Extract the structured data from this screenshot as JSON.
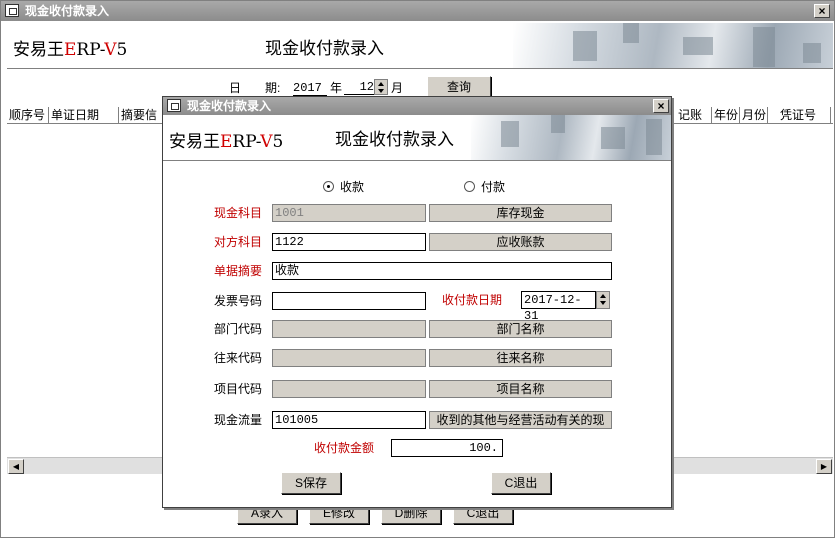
{
  "window": {
    "title": "现金收付款录入",
    "close_label": "×"
  },
  "main_banner": {
    "logo_prefix": "安易王",
    "logo_e": "E",
    "logo_mid": "RP-",
    "logo_v": "V",
    "logo_suffix": "5",
    "title": "现金收付款录入"
  },
  "filter": {
    "date_label": "日　　期:",
    "year": "2017",
    "year_unit": "年",
    "month": "12",
    "month_unit": "月",
    "query_button": "查询"
  },
  "columns": [
    "顺序号",
    "单证日期",
    "摘要信",
    "记账",
    "年份",
    "月份",
    "凭证号"
  ],
  "bottom_buttons": {
    "add": "A录入",
    "modify": "E修改",
    "delete": "D删除",
    "exit": "C退出"
  },
  "dialog": {
    "title": "现金收付款录入",
    "banner": {
      "logo_prefix": "安易王",
      "logo_e": "E",
      "logo_mid": "RP-",
      "logo_v": "V",
      "logo_suffix": "5",
      "title": "现金收付款录入"
    },
    "radio_receive": "收款",
    "radio_pay": "付款",
    "cash_account_label": "现金科目",
    "cash_account_value": "1001",
    "cash_account_name": "库存现金",
    "counter_account_label": "对方科目",
    "counter_account_value": "1122",
    "counter_account_name": "应收账款",
    "summary_label": "单据摘要",
    "summary_value": "收款",
    "invoice_label": "发票号码",
    "invoice_value": "",
    "date_label": "收付款日期",
    "date_value": "2017-12-31",
    "dept_label": "部门代码",
    "dept_name": "部门名称",
    "partner_label": "往来代码",
    "partner_name": "往来名称",
    "project_label": "项目代码",
    "project_name": "项目名称",
    "cashflow_label": "现金流量",
    "cashflow_value": "101005",
    "cashflow_name": "收到的其他与经营活动有关的现",
    "amount_label": "收付款金额",
    "amount_value": "100.",
    "save_button": "S保存",
    "exit_button": "C退出"
  },
  "colors": {
    "title_bar": "#8c8c8c",
    "red_label": "#c00000",
    "button_face": "#d4d0c8"
  }
}
